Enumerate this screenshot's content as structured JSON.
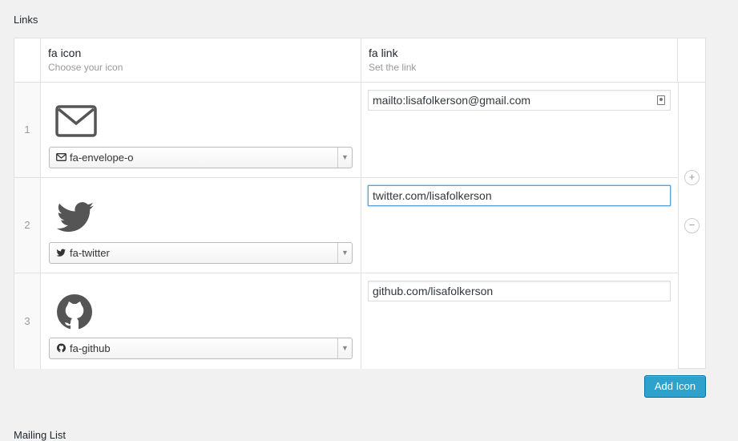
{
  "section": {
    "title": "Links",
    "next_title": "Mailing List"
  },
  "columns": {
    "icon": {
      "label": "fa icon",
      "sub": "Choose your icon"
    },
    "link": {
      "label": "fa link",
      "sub": "Set the link"
    }
  },
  "rows": [
    {
      "order": "1",
      "icon_name": "envelope-icon",
      "select_value": "fa-envelope-o",
      "link_value": "mailto:lisafolkerson@gmail.com"
    },
    {
      "order": "2",
      "icon_name": "twitter-icon",
      "select_value": "fa-twitter",
      "link_value": "twitter.com/lisafolkerson"
    },
    {
      "order": "3",
      "icon_name": "github-icon",
      "select_value": "fa-github",
      "link_value": "github.com/lisafolkerson"
    }
  ],
  "actions": {
    "add_row": "+",
    "remove_row": "−"
  },
  "add_button_label": "Add Icon",
  "colors": {
    "primary_button": "#2ea2cc",
    "focus_border": "#5b9dd9",
    "icon_gray": "#555555"
  }
}
